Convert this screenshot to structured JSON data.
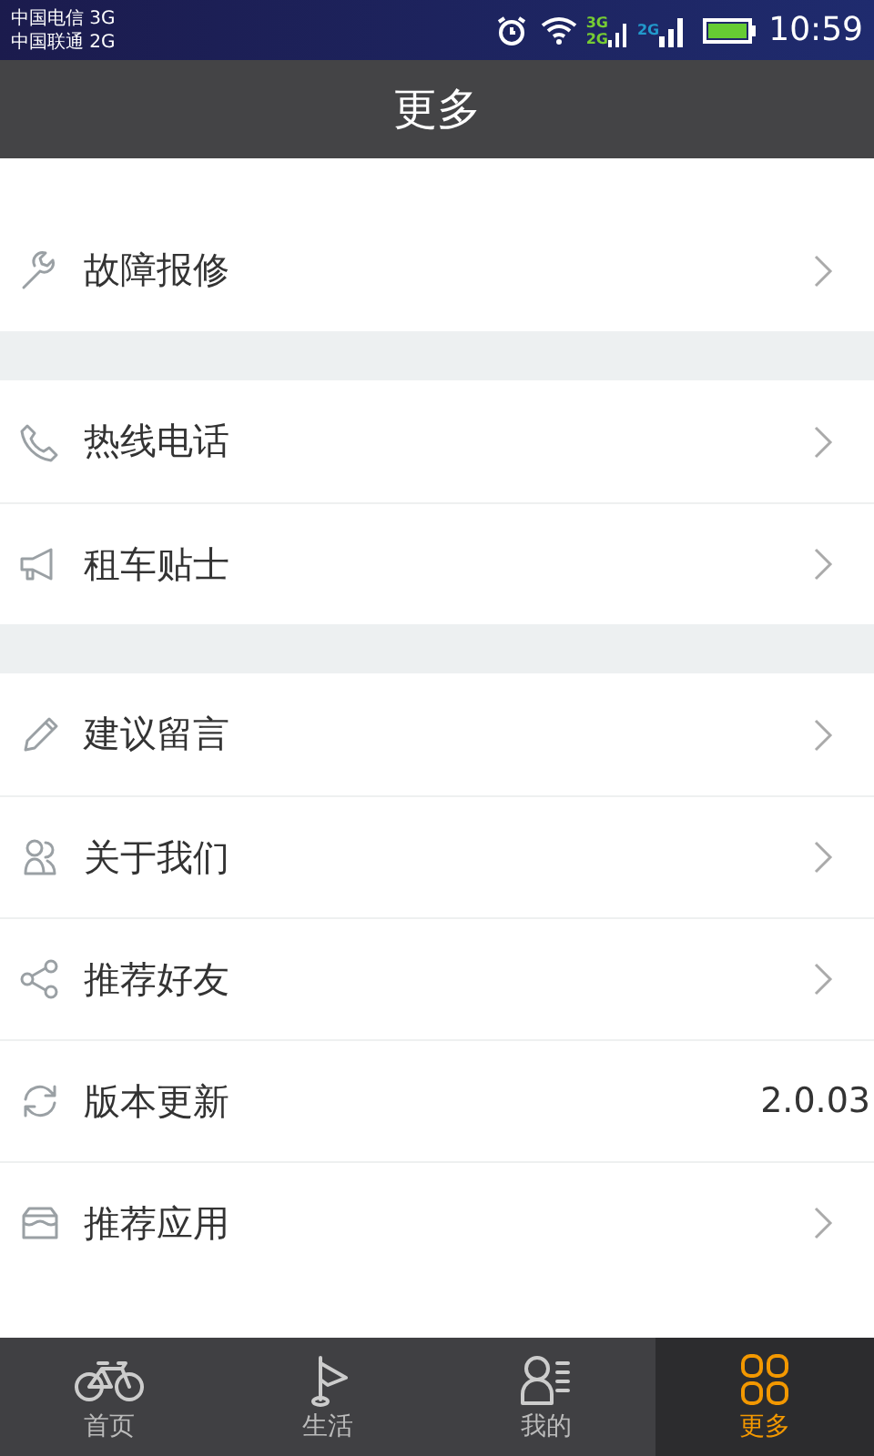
{
  "status_bar": {
    "carriers": [
      "中国电信 3G",
      "中国联通 2G"
    ],
    "network_labels": [
      "3G",
      "2G",
      "2G"
    ],
    "time": "10:59"
  },
  "header": {
    "title": "更多"
  },
  "groups": [
    {
      "items": [
        {
          "label": "故障报修"
        }
      ]
    },
    {
      "items": [
        {
          "label": "热线电话"
        },
        {
          "label": "租车贴士"
        }
      ]
    },
    {
      "items": [
        {
          "label": "建议留言"
        },
        {
          "label": "关于我们"
        },
        {
          "label": "推荐好友"
        },
        {
          "label": "版本更新",
          "value": "2.0.03"
        },
        {
          "label": "推荐应用"
        }
      ]
    }
  ],
  "tabs": [
    {
      "label": "首页",
      "selected": false
    },
    {
      "label": "生活",
      "selected": false
    },
    {
      "label": "我的",
      "selected": false
    },
    {
      "label": "更多",
      "selected": true
    }
  ]
}
